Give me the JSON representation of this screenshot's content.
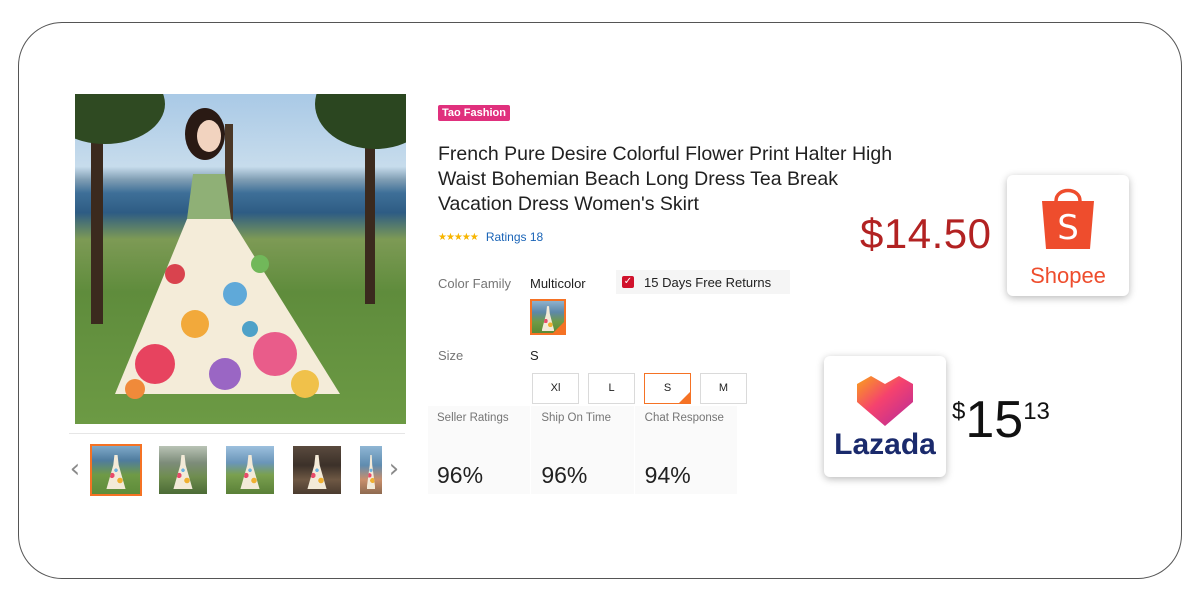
{
  "product": {
    "brand_tag": "Tao Fashion",
    "title": "French Pure Desire Colorful Flower Print Halter High Waist Bohemian Beach Long Dress Tea Break Vacation Dress Women's Skirt",
    "stars": "★★★★★",
    "ratings_text": "Ratings 18",
    "color_family_label": "Color Family",
    "color_family_value": "Multicolor",
    "returns_text": "15 Days Free Returns",
    "size_label": "Size",
    "size_value": "S",
    "sizes": [
      "Xl",
      "L",
      "S",
      "M"
    ],
    "selected_size": "S"
  },
  "gallery": {
    "prev_glyph": "‹",
    "next_glyph": "›"
  },
  "seller": {
    "metrics": [
      {
        "label": "Seller Ratings",
        "value": "96%"
      },
      {
        "label": "Ship On Time",
        "value": "96%"
      },
      {
        "label": "Chat Response",
        "value": "94%"
      }
    ]
  },
  "comparison": {
    "shopee": {
      "price": "$14.50",
      "logo_text": "Shopee",
      "logo_letter": "S",
      "color": "#ee4d2d"
    },
    "lazada": {
      "price_currency": "$",
      "price_integer": "15",
      "price_cents": "13",
      "logo_text": "Lazada",
      "color": "#1a2a6c"
    }
  },
  "colors": {
    "accent": "#f57224",
    "brand_tag_bg": "#e0307d",
    "link": "#1a64b7",
    "shopee_price": "#b22222"
  }
}
